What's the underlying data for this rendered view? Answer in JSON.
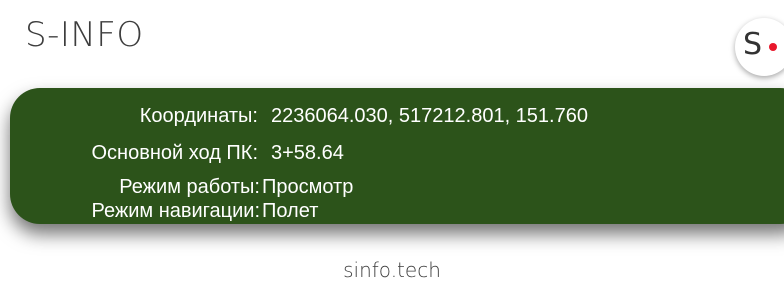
{
  "header": {
    "title": "S-INFO",
    "logo_letter": "S",
    "logo_dot_color": "#e8182c"
  },
  "info_panel": {
    "background_color": "#2c531a",
    "rows": [
      {
        "label": "Координаты:",
        "value": "2236064.030, 517212.801, 151.760"
      },
      {
        "label": "Основной ход ПК:",
        "value": "3+58.64"
      },
      {
        "label": "Режим работы:",
        "value": "Просмотр"
      },
      {
        "label": "Режим навигации:",
        "value": "Полет"
      }
    ]
  },
  "footer": {
    "link_text": "sinfo.tech"
  }
}
